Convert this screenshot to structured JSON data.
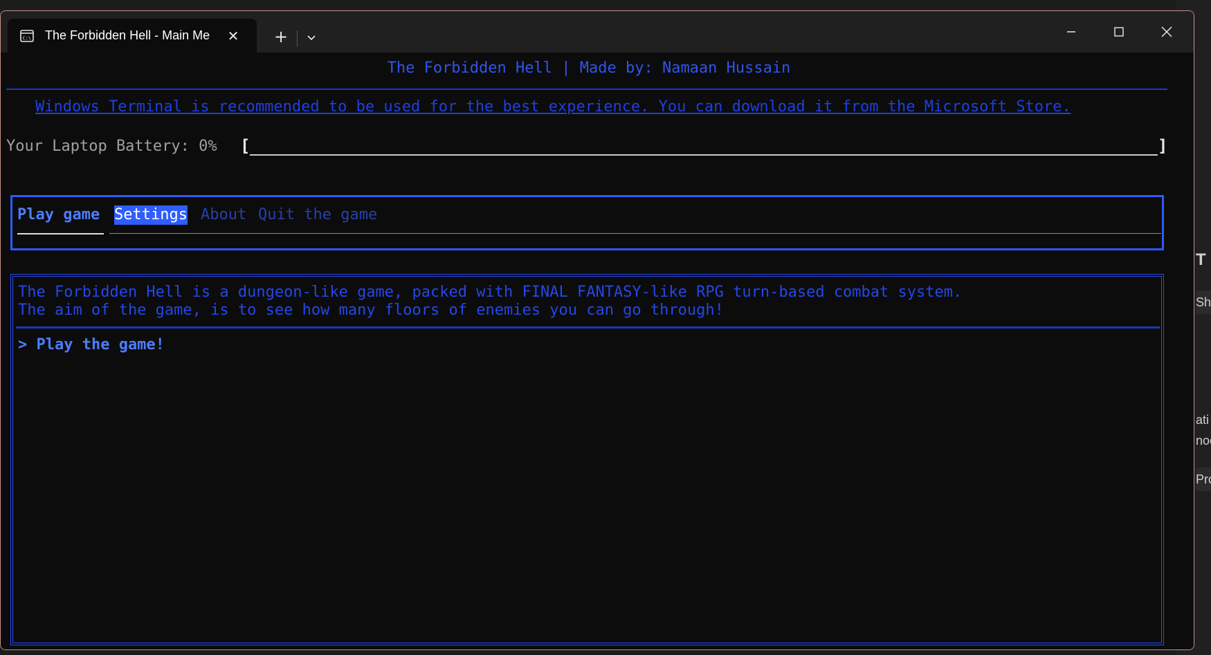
{
  "window": {
    "tab_title": "The Forbidden Hell - Main Me",
    "tab_icon": "terminal-icon",
    "close_tab_glyph": "✕",
    "new_tab_glyph": "+",
    "dropdown_icon": "chevron-down-icon"
  },
  "header": {
    "title": "The Forbidden Hell | Made by: Namaan Hussain"
  },
  "notice": {
    "text": "Windows Terminal is recommended to be used for the best experience. You can download it from the Microsoft Store."
  },
  "battery": {
    "label": "Your Laptop Battery: 0%",
    "level_percent": 0,
    "open_bracket": "[",
    "close_bracket": "]"
  },
  "menu": {
    "items": [
      {
        "label": "Play game",
        "state": "active"
      },
      {
        "label": "Settings",
        "state": "highlighted"
      },
      {
        "label": "About",
        "state": "inactive"
      },
      {
        "label": "Quit the game",
        "state": "inactive"
      }
    ]
  },
  "content": {
    "line1": "The Forbidden Hell is a dungeon-like game, packed with FINAL FANTASY-like RPG turn-based combat system.",
    "line2": "The aim of the game, is to see how many floors of enemies you can go through!",
    "prompt": "> Play the game!"
  },
  "desktop_right": {
    "fragments": [
      "T",
      "Sh",
      "ati",
      "noc",
      "Pro"
    ]
  },
  "colors": {
    "accent_blue": "#2b5cff",
    "text_blue": "#2447ea",
    "terminal_bg": "#0c0c0c"
  }
}
